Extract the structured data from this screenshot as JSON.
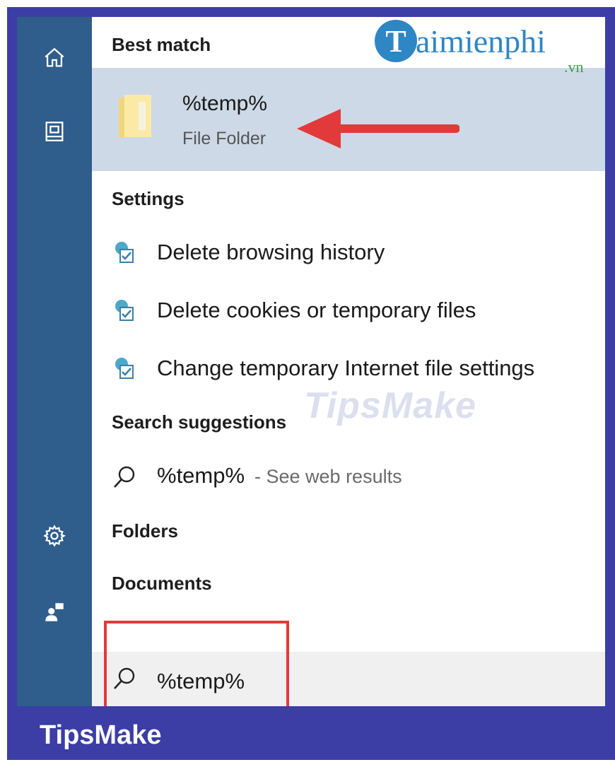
{
  "sidebar": {
    "icons": [
      "home-icon",
      "document-icon",
      "gear-icon",
      "feedback-icon"
    ]
  },
  "best_match": {
    "heading": "Best match",
    "title": "%temp%",
    "subtitle": "File Folder"
  },
  "settings": {
    "heading": "Settings",
    "items": [
      {
        "label": "Delete browsing history"
      },
      {
        "label": "Delete cookies or temporary files"
      },
      {
        "label": "Change temporary Internet file settings"
      }
    ]
  },
  "search_suggestions": {
    "heading": "Search suggestions",
    "term": "%temp%",
    "sub": "- See web results"
  },
  "folders_heading": "Folders",
  "documents_heading": "Documents",
  "search_box": {
    "value": "%temp%"
  },
  "logo": {
    "letter": "T",
    "text": "aimienphi",
    "suffix": ".vn"
  },
  "watermark": "TipsMake",
  "brand": "TipsMake",
  "colors": {
    "sidebar": "#2f5d8c",
    "selected_row": "#cdd9e6",
    "frame": "#3c3ea5",
    "annotation_red": "#e23a3a"
  }
}
